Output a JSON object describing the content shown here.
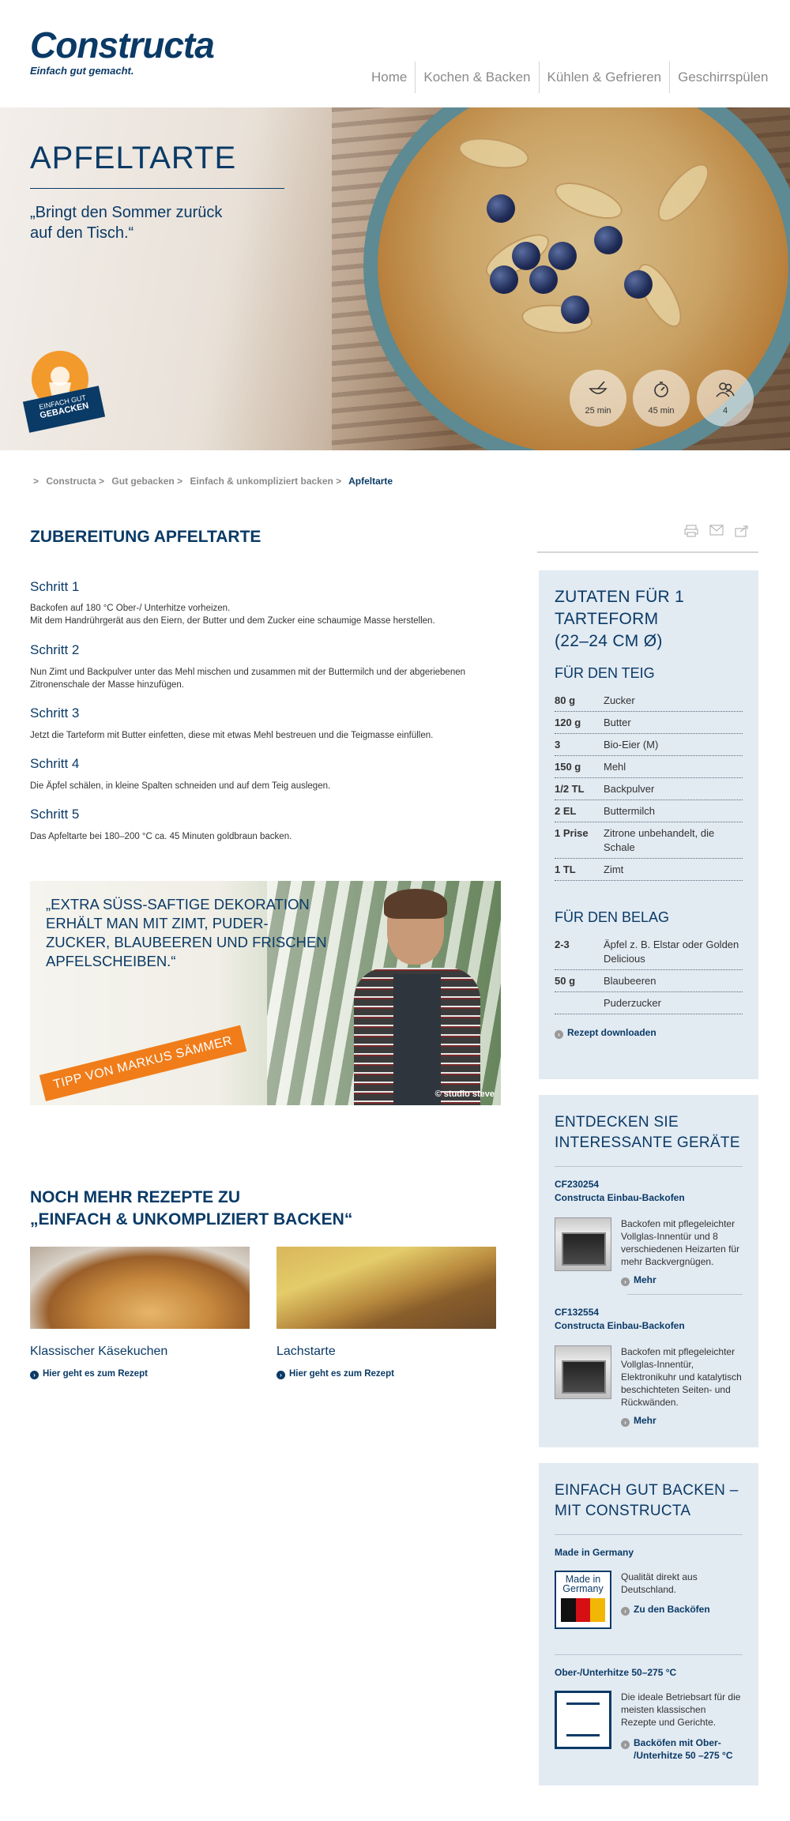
{
  "header": {
    "logo": "Constructa",
    "tagline": "Einfach gut gemacht.",
    "nav": [
      "Home",
      "Kochen & Backen",
      "Kühlen & Gefrieren",
      "Geschirrspülen"
    ]
  },
  "hero": {
    "title": "APFELTARTE",
    "quote_line1": "„Bringt den Sommer zurück",
    "quote_line2": "auf den Tisch.“",
    "badge_line1": "EINFACH GUT",
    "badge_line2": "GEBACKEN",
    "prep_time": "25 min",
    "bake_time": "45 min",
    "servings": "4"
  },
  "breadcrumb": {
    "items": [
      "Constructa",
      "Gut gebacken",
      "Einfach & unkompliziert backen"
    ],
    "current": "Apfeltarte",
    "separator": ">"
  },
  "main": {
    "heading": "ZUBEREITUNG APFELTARTE",
    "steps": [
      {
        "title": "Schritt 1",
        "text1": "Backofen auf 180 °C Ober-/ Unterhitze vorheizen.",
        "text2": "Mit dem Handrührgerät aus den Eiern, der Butter und dem Zucker eine schaumige Masse herstellen."
      },
      {
        "title": "Schritt 2",
        "text1": "Nun Zimt und Backpulver unter das Mehl mischen und zusammen mit der Buttermilch und der abgeriebenen",
        "text2": "Zitronenschale der Masse hinzufügen."
      },
      {
        "title": "Schritt 3",
        "text1": "Jetzt die Tarteform mit Butter einfetten, diese mit etwas Mehl bestreuen und die Teigmasse einfüllen.",
        "text2": ""
      },
      {
        "title": "Schritt 4",
        "text1": "Die Äpfel schälen, in kleine Spalten schneiden und auf dem Teig auslegen.",
        "text2": ""
      },
      {
        "title": "Schritt 5",
        "text1": "Das Apfeltarte bei 180–200 °C ca. 45 Minuten goldbraun backen.",
        "text2": ""
      }
    ],
    "tip": {
      "quote_lines": [
        "„EXTRA SÜSS-SAFTIGE DEKORATION",
        "ERHÄLT MAN MIT ZIMT, PUDER-",
        "ZUCKER, BLAUBEEREN UND FRISCHEN",
        "APFELSCHEIBEN.“"
      ],
      "credit": "© studio steve",
      "banner": "TIPP VON MARKUS SÄMMER"
    },
    "more": {
      "heading_line1": "NOCH MEHR REZEPTE ZU",
      "heading_line2": "„EINFACH & UNKOMPLIZIERT BACKEN“",
      "recipes": [
        {
          "title": "Klassischer Käsekuchen",
          "link": "Hier geht es zum Rezept"
        },
        {
          "title": "Lachstarte",
          "link": "Hier geht es zum Rezept"
        }
      ]
    }
  },
  "sidebar": {
    "ingredients": {
      "title_line1": "ZUTATEN FÜR 1",
      "title_line2": "TARTEFORM",
      "title_line3": "(22–24 CM Ø)",
      "dough_title": "FÜR DEN TEIG",
      "dough": [
        {
          "qty": "80 g",
          "name": "Zucker"
        },
        {
          "qty": "120 g",
          "name": "Butter"
        },
        {
          "qty": "3",
          "name": "Bio-Eier (M)"
        },
        {
          "qty": "150 g",
          "name": "Mehl"
        },
        {
          "qty": "1/2 TL",
          "name": "Backpulver"
        },
        {
          "qty": "2 EL",
          "name": "Buttermilch"
        },
        {
          "qty": "1 Prise",
          "name": "Zitrone unbehandelt, die Schale"
        },
        {
          "qty": "1 TL",
          "name": "Zimt"
        }
      ],
      "topping_title": "FÜR DEN BELAG",
      "topping": [
        {
          "qty": "2-3",
          "name": "Äpfel z. B. Elstar oder Golden Delicious"
        },
        {
          "qty": "50 g",
          "name": "Blaubeeren"
        },
        {
          "qty": "",
          "name": "Puderzucker"
        }
      ],
      "download": "Rezept downloaden"
    },
    "devices": {
      "title_line1": "ENTDECKEN SIE",
      "title_line2": "INTERESSANTE GERÄTE",
      "items": [
        {
          "model": "CF230254",
          "name": "Constructa Einbau-Backofen",
          "text": [
            "Backofen mit pflegeleichter",
            "Vollglas-Innentür und 8",
            "verschiedenen Heizarten für",
            "mehr Backvergnügen."
          ],
          "link": "Mehr"
        },
        {
          "model": "CF132554",
          "name": "Constructa Einbau-Backofen",
          "text": [
            "Backofen mit pflegeleichter",
            "Vollglas-Innentür,",
            "Elektronikuhr und katalytisch",
            "beschichteten Seiten- und",
            "Rückwänden."
          ],
          "link": "Mehr"
        }
      ]
    },
    "baking": {
      "title_line1": "EINFACH GUT BACKEN –",
      "title_line2": "MIT CONSTRUCTA",
      "mig_title": "Made in Germany",
      "mig_logo_line1": "Made in",
      "mig_logo_line2": "Germany",
      "mig_text": [
        "Qualität direkt aus",
        "Deutschland."
      ],
      "mig_link": "Zu den Backöfen",
      "heat_title": "Ober-/Unterhitze 50–275 °C",
      "heat_text": [
        "Die ideale Betriebsart für die",
        "meisten klassischen",
        "Rezepte und Gerichte."
      ],
      "heat_link_line1": "Backöfen mit Ober-",
      "heat_link_line2": "/Unterhitze 50 –275 °C"
    }
  },
  "colors": {
    "brand_blue": "#0a3a66",
    "accent_orange": "#f07d1a",
    "sidebar_bg": "#e2eaf2",
    "nav_grey": "#8a8a8a"
  },
  "icons": {
    "prep": "whisk-bowl-icon",
    "bake": "timer-icon",
    "servings": "people-icon",
    "print": "print-icon",
    "mail": "mail-icon",
    "share": "share-icon"
  }
}
